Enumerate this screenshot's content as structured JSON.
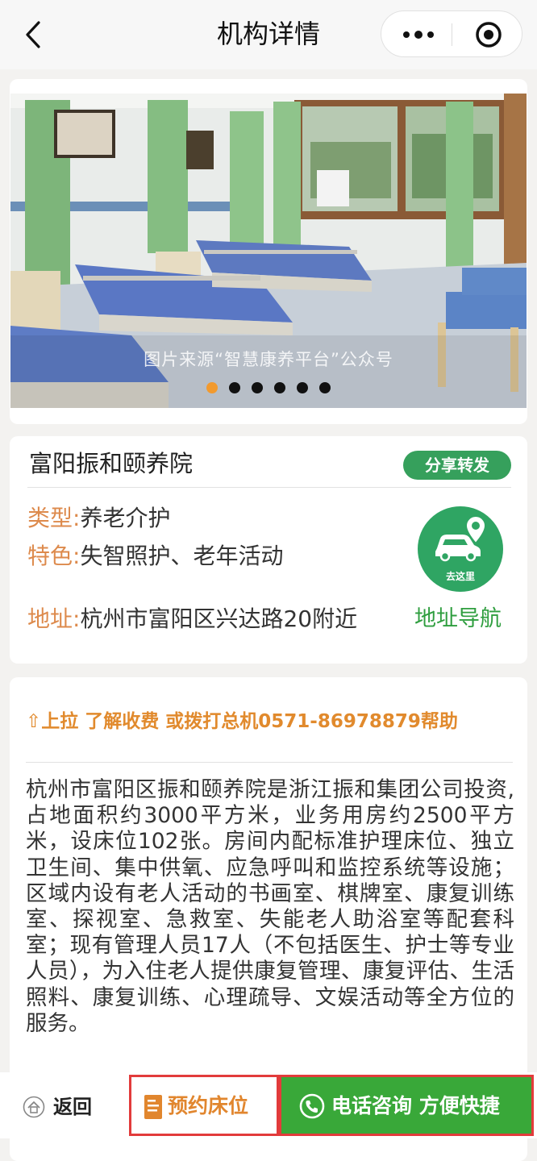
{
  "navbar": {
    "title": "机构详情",
    "back_icon": "chevron-left-icon",
    "more_icon": "more-dots-icon",
    "close_icon": "target-circle-icon"
  },
  "banner": {
    "watermark": "图片来源“智慧康养平台”公众号",
    "slide_count": 6,
    "active_slide": 1
  },
  "info": {
    "name": "富阳振和颐养院",
    "share_label": "分享转发",
    "type_label": "类型:",
    "type_value": "养老介护",
    "feature_label": "特色:",
    "feature_value": "失智照护、老年活动",
    "address_label": "地址:",
    "address_value": "杭州市富阳区兴达路20附近",
    "nav_badge_text": "去这里",
    "nav_link": "地址导航"
  },
  "description": {
    "pullup_arrow": "⇧",
    "pullup_text": "上拉 了解收费 或拨打总机0571-86978879帮助",
    "body": "杭州市富阳区振和颐养院是浙江振和集团公司投资,占地面积约3000平方米，业务用房约2500平方米，设床位102张。房间内配标准护理床位、独立卫生间、集中供氧、应急呼叫和监控系统等设施；区域内设有老人活动的书画室、棋牌室、康复训练室、探视室、急救室、失能老人助浴室等配套科室；现有管理人员17人（不包括医生、护士等专业人员），为入住老人提供康复管理、康复评估、生活照料、康复训练、心理疏导、文娱活动等全方位的服务。"
  },
  "bottom_bar": {
    "home_label": "返回",
    "reserve_label": "预约床位",
    "call_label": "电话咨询 方便快捷"
  },
  "colors": {
    "accent_orange": "#e1862e",
    "label_orange": "#dd8a4c",
    "green": "#36a05c",
    "call_green": "#39a839",
    "highlight_red": "#e23b3b",
    "active_dot": "#f29a2e"
  }
}
